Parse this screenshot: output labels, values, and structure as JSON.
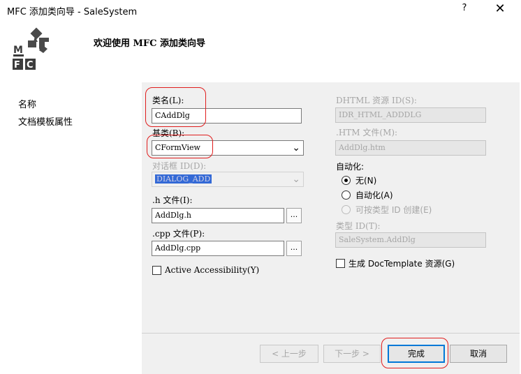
{
  "window": {
    "title": "MFC 添加类向导 - SaleSystem",
    "help": "?",
    "close": "✕"
  },
  "header": {
    "title": "欢迎使用 MFC 添加类向导",
    "logo_text": [
      "M",
      "F",
      "C"
    ]
  },
  "sidebar": {
    "items": [
      {
        "label": "名称"
      },
      {
        "label": "文档模板属性"
      }
    ]
  },
  "form": {
    "class_name_label": "类名(L):",
    "class_name_value": "CAddDlg",
    "base_class_label": "基类(B):",
    "base_class_value": "CFormView",
    "dialog_id_label": "对话框 ID(D):",
    "dialog_id_value": "DIALOG_ADD",
    "h_file_label": ".h 文件(I):",
    "h_file_value": "AddDlg.h",
    "cpp_file_label": ".cpp 文件(P):",
    "cpp_file_value": "AddDlg.cpp",
    "browse_label": "...",
    "active_accessibility_label": "Active Accessibility(Y)",
    "dhtml_id_label": "DHTML 资源 ID(S):",
    "dhtml_id_value": "IDR_HTML_ADDDLG",
    "htm_file_label": ".HTM 文件(M):",
    "htm_file_value": "AddDlg.htm",
    "automation_label": "自动化:",
    "radio_none": "无(N)",
    "radio_automation": "自动化(A)",
    "radio_typeid": "可按类型 ID 创建(E)",
    "type_id_label": "类型 ID(T):",
    "type_id_value": "SaleSystem.AddDlg",
    "doctemplate_label": "生成 DocTemplate 资源(G)"
  },
  "buttons": {
    "prev": "< 上一步",
    "next": "下一步 >",
    "finish": "完成",
    "cancel": "取消"
  },
  "colors": {
    "highlight_red": "#e01d1d",
    "panel_bg": "#f0f0f0",
    "accent_blue": "#0078d7"
  }
}
